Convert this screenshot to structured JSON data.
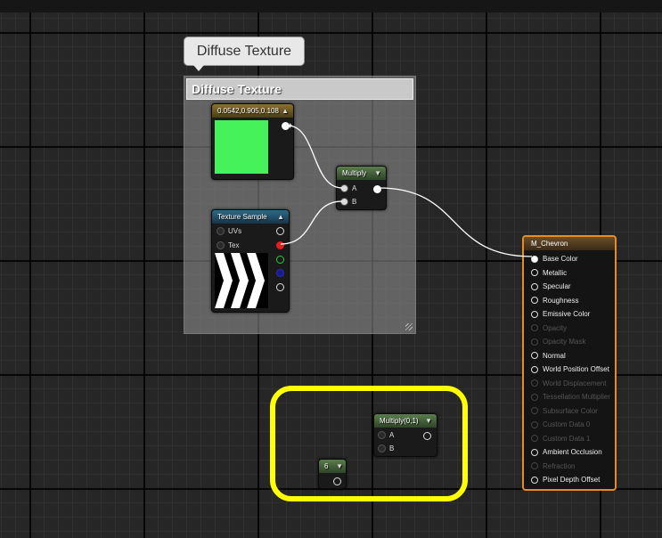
{
  "comment": {
    "bubble_text": "Diffuse Texture",
    "header_text": "Diffuse Texture"
  },
  "constant_node": {
    "title": "0.0542,0.905,0.108",
    "swatch_color": "#45f25a"
  },
  "texture_node": {
    "title": "Texture Sample",
    "pins": [
      "UVs",
      "Tex"
    ]
  },
  "multiply_node": {
    "title": "Multiply",
    "pins": [
      "A",
      "B"
    ]
  },
  "multiply2_node": {
    "title": "Multiply(0,1)",
    "pins": [
      "A",
      "B"
    ]
  },
  "scalar_node": {
    "title": "6"
  },
  "result_node": {
    "title": "M_Chevron",
    "pins": [
      {
        "label": "Base Color",
        "enabled": true
      },
      {
        "label": "Metallic",
        "enabled": true
      },
      {
        "label": "Specular",
        "enabled": true
      },
      {
        "label": "Roughness",
        "enabled": true
      },
      {
        "label": "Emissive Color",
        "enabled": true
      },
      {
        "label": "Opacity",
        "enabled": false
      },
      {
        "label": "Opacity Mask",
        "enabled": false
      },
      {
        "label": "Normal",
        "enabled": true
      },
      {
        "label": "World Position Offset",
        "enabled": true
      },
      {
        "label": "World Displacement",
        "enabled": false
      },
      {
        "label": "Tessellation Multiplier",
        "enabled": false
      },
      {
        "label": "Subsurface Color",
        "enabled": false
      },
      {
        "label": "Custom Data 0",
        "enabled": false
      },
      {
        "label": "Custom Data 1",
        "enabled": false
      },
      {
        "label": "Ambient Occlusion",
        "enabled": true
      },
      {
        "label": "Refraction",
        "enabled": false
      },
      {
        "label": "Pixel Depth Offset",
        "enabled": true
      }
    ]
  },
  "colors": {
    "highlight": "#ffff00",
    "result_border": "#e58d1e",
    "wire": "#ffffff"
  }
}
